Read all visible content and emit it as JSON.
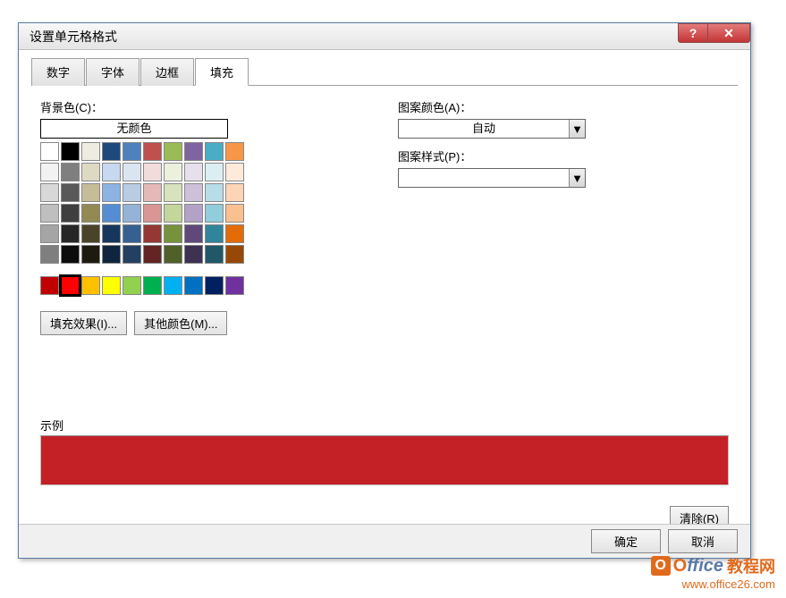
{
  "window": {
    "title": "设置单元格格式"
  },
  "tabs": {
    "number": "数字",
    "font": "字体",
    "border": "边框",
    "fill": "填充"
  },
  "fill": {
    "bgcolor_label": "背景色(C)：",
    "nocolor": "无颜色",
    "fill_effects_btn": "填充效果(I)...",
    "more_colors_btn": "其他颜色(M)...",
    "pattern_color_label": "图案颜色(A)：",
    "pattern_color_value": "自动",
    "pattern_style_label": "图案样式(P)：",
    "pattern_style_value": ""
  },
  "example": {
    "label": "示例",
    "color": "#c42127"
  },
  "buttons": {
    "clear": "清除(R)",
    "ok": "确定",
    "cancel": "取消"
  },
  "watermark": {
    "brand_o": "O",
    "brand_rest": "ffice",
    "brand_cn": "教程网",
    "url": "www.office26.com"
  },
  "palette_theme": [
    [
      "#ffffff",
      "#000000",
      "#eeece1",
      "#1f497d",
      "#4f81bd",
      "#c0504d",
      "#9bbb59",
      "#8064a2",
      "#4bacc6",
      "#f79646"
    ],
    [
      "#f2f2f2",
      "#7f7f7f",
      "#ddd9c3",
      "#c6d9f0",
      "#dbe5f1",
      "#f2dcdb",
      "#ebf1dd",
      "#e5e0ec",
      "#dbeef3",
      "#fdeada"
    ],
    [
      "#d8d8d8",
      "#595959",
      "#c4bd97",
      "#8db3e2",
      "#b8cce4",
      "#e5b9b7",
      "#d7e3bc",
      "#ccc1d9",
      "#b7dde8",
      "#fbd5b5"
    ],
    [
      "#bfbfbf",
      "#3f3f3f",
      "#938953",
      "#548dd4",
      "#95b3d7",
      "#d99694",
      "#c3d69b",
      "#b2a2c7",
      "#92cddc",
      "#fac08f"
    ],
    [
      "#a5a5a5",
      "#262626",
      "#494429",
      "#17365d",
      "#366092",
      "#953734",
      "#76923c",
      "#5f497a",
      "#31859b",
      "#e36c09"
    ],
    [
      "#7f7f7f",
      "#0c0c0c",
      "#1d1b10",
      "#0f243e",
      "#244061",
      "#632423",
      "#4f6128",
      "#3f3151",
      "#205867",
      "#974806"
    ]
  ],
  "palette_standard": [
    "#c00000",
    "#ff0000",
    "#ffc000",
    "#ffff00",
    "#92d050",
    "#00b050",
    "#00b0f0",
    "#0070c0",
    "#002060",
    "#7030a0"
  ],
  "selected_standard_index": 1
}
